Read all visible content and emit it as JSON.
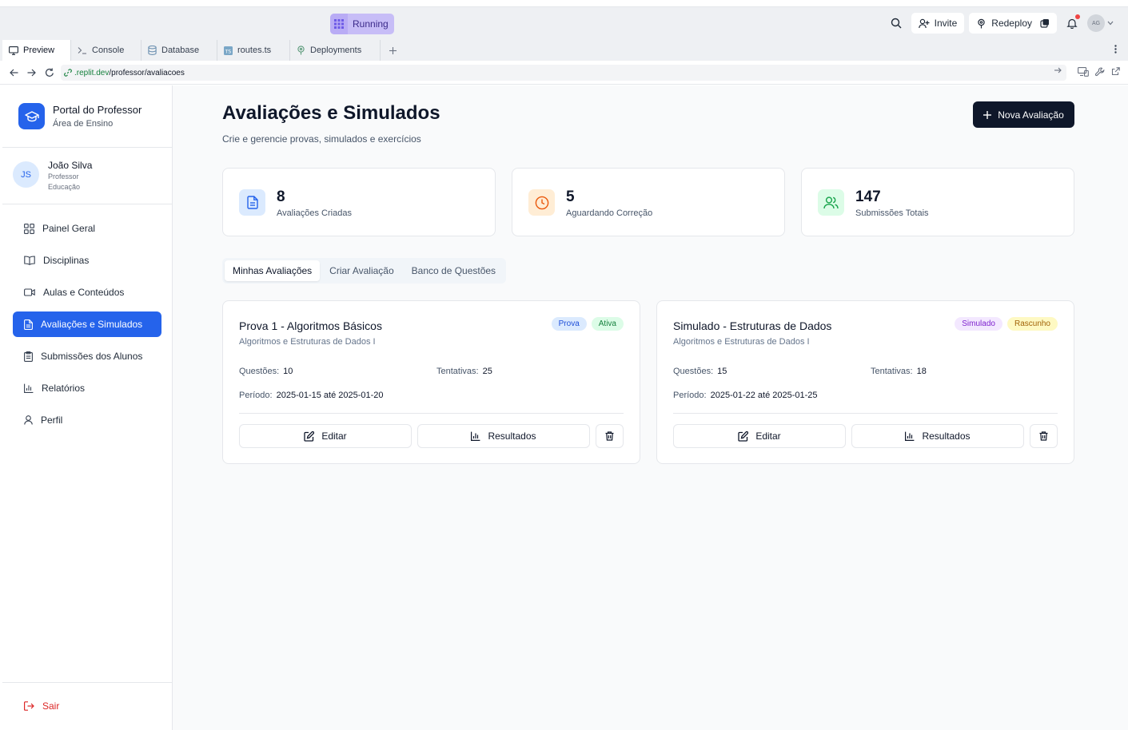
{
  "topbar": {
    "run_status": "Running",
    "invite_label": "Invite",
    "redeploy_label": "Redeploy",
    "avatar_initials": "AG"
  },
  "ide_tabs": [
    {
      "label": "Preview",
      "icon": "monitor-icon"
    },
    {
      "label": "Console",
      "icon": "terminal-icon"
    },
    {
      "label": "Database",
      "icon": "database-icon"
    },
    {
      "label": "routes.ts",
      "icon": "typescript-file-icon"
    },
    {
      "label": "Deployments",
      "icon": "deploy-icon"
    }
  ],
  "address": {
    "host": ".replit.dev",
    "path": "/professor/avaliacoes"
  },
  "brand": {
    "title": "Portal do Professor",
    "subtitle": "Área de Ensino"
  },
  "user": {
    "initials": "JS",
    "name": "João Silva",
    "role": "Professor",
    "department": "Educação"
  },
  "sidebar": {
    "items": [
      {
        "label": "Painel Geral",
        "icon": "dashboard-icon"
      },
      {
        "label": "Disciplinas",
        "icon": "book-icon"
      },
      {
        "label": "Aulas e Conteúdos",
        "icon": "video-icon"
      },
      {
        "label": "Avaliações e Simulados",
        "icon": "file-text-icon",
        "active": true
      },
      {
        "label": "Submissões dos Alunos",
        "icon": "clipboard-icon"
      },
      {
        "label": "Relatórios",
        "icon": "bar-chart-icon"
      },
      {
        "label": "Perfil",
        "icon": "user-icon"
      }
    ],
    "logout_label": "Sair"
  },
  "page": {
    "title": "Avaliações e Simulados",
    "subtitle": "Crie e gerencie provas, simulados e exercícios",
    "new_button": "Nova Avaliação"
  },
  "stats": [
    {
      "value": "8",
      "label": "Avaliações Criadas",
      "color": "#2563eb",
      "bg": "#dbeafe"
    },
    {
      "value": "5",
      "label": "Aguardando Correção",
      "color": "#ea580c",
      "bg": "#ffedd5"
    },
    {
      "value": "147",
      "label": "Submissões Totais",
      "color": "#16a34a",
      "bg": "#dcfce7"
    }
  ],
  "tabs": [
    {
      "label": "Minhas Avaliações",
      "active": true
    },
    {
      "label": "Criar Avaliação"
    },
    {
      "label": "Banco de Questões"
    }
  ],
  "labels": {
    "questions": "Questões:",
    "attempts": "Tentativas:",
    "period": "Período:",
    "edit": "Editar",
    "results": "Resultados"
  },
  "assessments": [
    {
      "title": "Prova 1 - Algoritmos Básicos",
      "course": "Algoritmos e Estruturas de Dados I",
      "badges": [
        {
          "label": "Prova",
          "bg": "#dbeafe",
          "color": "#1d4ed8"
        },
        {
          "label": "Ativa",
          "bg": "#dcfce7",
          "color": "#15803d"
        }
      ],
      "questions": "10",
      "attempts": "25",
      "period": "2025-01-15 até 2025-01-20"
    },
    {
      "title": "Simulado - Estruturas de Dados",
      "course": "Algoritmos e Estruturas de Dados I",
      "badges": [
        {
          "label": "Simulado",
          "bg": "#f3e8ff",
          "color": "#7e22ce"
        },
        {
          "label": "Rascunho",
          "bg": "#fef9c3",
          "color": "#a16207"
        }
      ],
      "questions": "15",
      "attempts": "18",
      "period": "2025-01-22 até 2025-01-25"
    }
  ]
}
